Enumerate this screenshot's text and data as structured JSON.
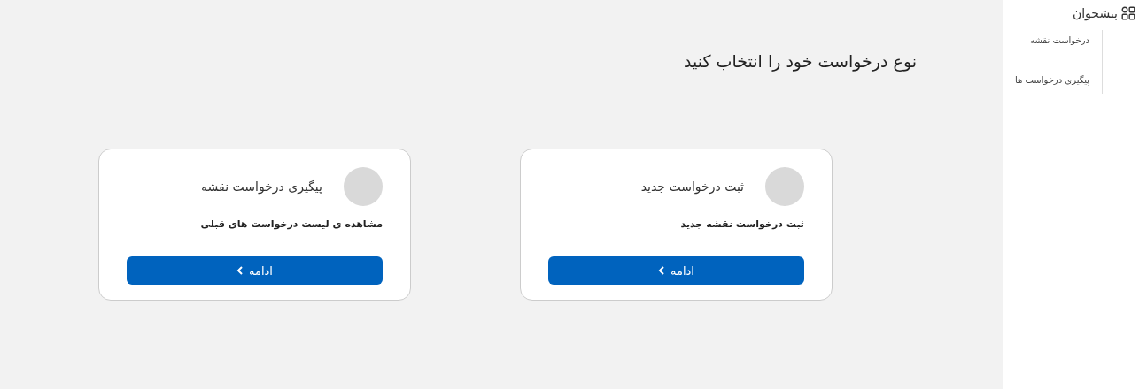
{
  "sidebar": {
    "title": "پیشخوان",
    "items": [
      {
        "label": "درخواست نقشه"
      },
      {
        "label": "پیگیری درخواست ها"
      }
    ]
  },
  "heading": "نوع درخواست خود را انتخاب کنید",
  "cards": [
    {
      "title": "ثبت درخواست جدید",
      "description": "ثبت درخواست نقشه جدید",
      "button": "ادامه"
    },
    {
      "title": "پیگیری درخواست نقشه",
      "description": "مشاهده ی لیست درخواست های قبلی",
      "button": "ادامه"
    }
  ]
}
